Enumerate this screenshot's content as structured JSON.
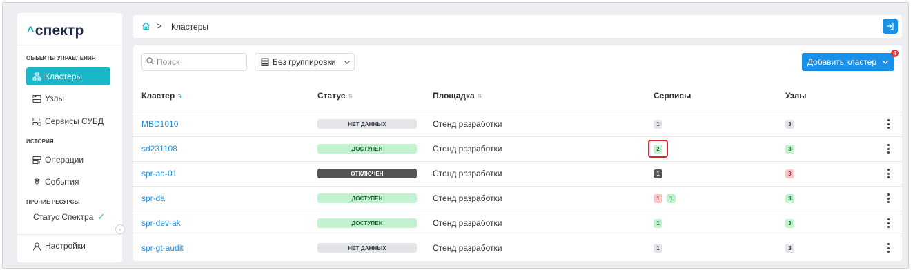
{
  "logo": {
    "caret": "^",
    "text": "спектр"
  },
  "sidebar": {
    "sections": [
      {
        "title": "ОБЪЕКТЫ УПРАВЛЕНИЯ"
      },
      {
        "title": "ИСТОРИЯ"
      },
      {
        "title": "ПРОЧИЕ РЕСУРСЫ"
      }
    ],
    "items": [
      {
        "label": "Кластеры",
        "icon": "clusters-icon",
        "active": true
      },
      {
        "label": "Узлы",
        "icon": "nodes-icon"
      },
      {
        "label": "Сервисы СУБД",
        "icon": "db-services-icon"
      },
      {
        "label": "Операции",
        "icon": "operations-icon"
      },
      {
        "label": "События",
        "icon": "events-icon"
      },
      {
        "label": "Статус Спектра",
        "icon": "check-icon"
      },
      {
        "label": "Настройки",
        "icon": "user-icon"
      }
    ]
  },
  "breadcrumb": {
    "home_icon": "home-icon",
    "separator": ">",
    "current": "Кластеры"
  },
  "toolbar": {
    "search_placeholder": "Поиск",
    "grouping_label": "Без группировки",
    "add_button_label": "Добавить кластер",
    "notification_count": "4"
  },
  "table": {
    "headers": {
      "cluster": "Кластер",
      "status": "Статус",
      "site": "Площадка",
      "services": "Сервисы",
      "nodes": "Узлы"
    },
    "rows": [
      {
        "name": "MBD1010",
        "status": "НЕТ ДАННЫХ",
        "site": "Стенд разработки",
        "services": [
          "1"
        ],
        "nodes": [
          "3"
        ]
      },
      {
        "name": "sd231108",
        "status": "ДОСТУПЕН",
        "site": "Стенд разработки",
        "services": [
          "2"
        ],
        "nodes": [
          "3"
        ]
      },
      {
        "name": "spr-aa-01",
        "status": "ОТКЛЮЧЁН",
        "site": "Стенд разработки",
        "services": [
          "1"
        ],
        "nodes": [
          "3"
        ]
      },
      {
        "name": "spr-da",
        "status": "ДОСТУПЕН",
        "site": "Стенд разработки",
        "services": [
          "1",
          "1"
        ],
        "nodes": [
          "3"
        ]
      },
      {
        "name": "spr-dev-ak",
        "status": "ДОСТУПЕН",
        "site": "Стенд разработки",
        "services": [
          "1"
        ],
        "nodes": [
          "3"
        ]
      },
      {
        "name": "spr-gt-audit",
        "status": "НЕТ ДАННЫХ",
        "site": "Стенд разработки",
        "services": [
          "1"
        ],
        "nodes": [
          "3"
        ]
      }
    ]
  },
  "colors": {
    "accent": "#19b7c8",
    "primary": "#1a90e8",
    "status_ok": "#c3f2d0",
    "status_nodata": "#e3e5e9",
    "status_off": "#545454",
    "error_badge": "#f9c9c9",
    "highlight": "#d6262c"
  }
}
